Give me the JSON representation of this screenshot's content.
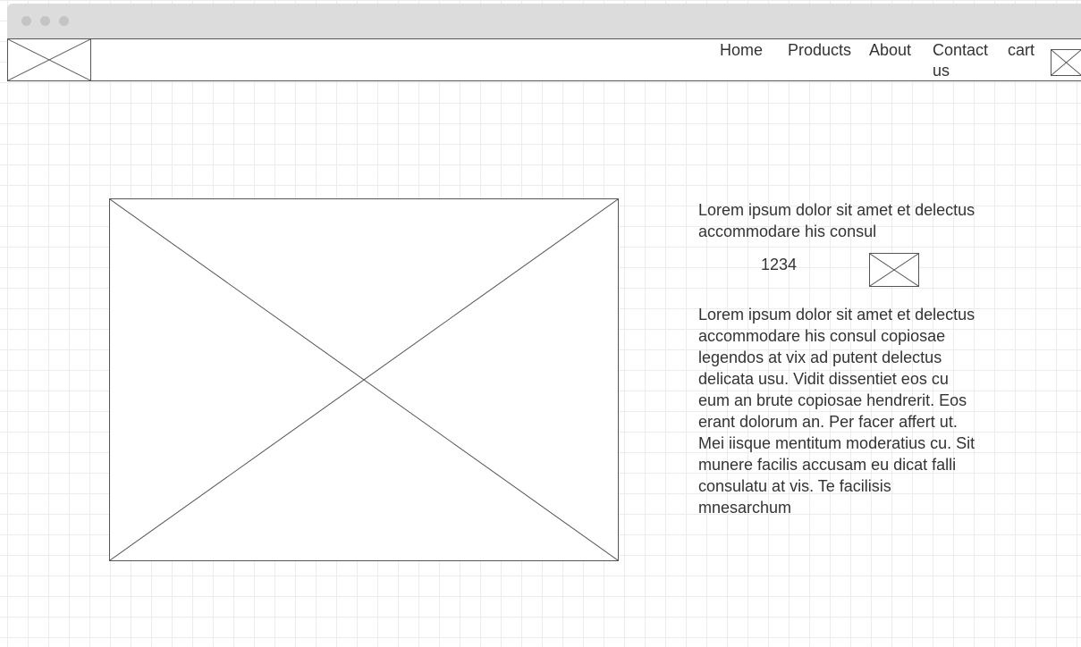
{
  "nav": {
    "items": [
      {
        "label": "Home"
      },
      {
        "label": "Products"
      },
      {
        "label": "About"
      },
      {
        "label": "Contact us"
      },
      {
        "label": "cart"
      }
    ]
  },
  "product": {
    "summary": "Lorem ipsum dolor sit amet et delectus accommodare his consul",
    "price": "1234",
    "description": "Lorem ipsum dolor sit amet et delectus accommodare his consul copiosae legendos at vix ad putent delectus delicata usu. Vidit dissentiet eos cu eum an brute copiosae hendrerit. Eos erant dolorum an. Per facer affert ut. Mei iisque mentitum moderatius cu. Sit munere facilis accusam eu dicat falli consulatu at vis. Te facilisis mnesarchum"
  },
  "colors": {
    "titlebar": "#dcdcdc",
    "window_dot": "#c4c4c4",
    "wireframe_line": "#555555",
    "grid": "#ececec",
    "text": "#333333"
  },
  "icons": {
    "logo": "image-placeholder-icon",
    "cart": "image-placeholder-icon",
    "product_image": "image-placeholder-icon",
    "add_to_cart": "image-placeholder-icon"
  }
}
